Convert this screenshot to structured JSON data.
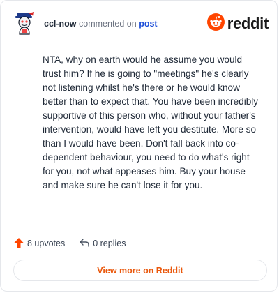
{
  "header": {
    "username": "ccl-now",
    "action": "commented on",
    "post_link": "post",
    "brand": "reddit"
  },
  "comment": {
    "text": "NTA, why on earth would he assume you would trust him? If he is going to \"meetings\" he's clearly not listening whilst he's there or he would know better than to expect that. You have been incredibly supportive of this person who, without your father's intervention, would have left you destitute. More so than I would have been. Don't fall back into co-dependent behaviour, you need to do what's right for you, not what appeases him. Buy your house and make sure he can't lose it for you."
  },
  "stats": {
    "upvotes": "8 upvotes",
    "replies": "0 replies"
  },
  "footer": {
    "view_more": "View more on Reddit"
  },
  "colors": {
    "brand_orange": "#ff4500",
    "link_blue": "#1d4ed8",
    "cta_orange": "#ea580c"
  },
  "icons": {
    "avatar": "snoo-avatar-icon",
    "brand": "reddit-logo-icon",
    "upvote": "upvote-arrow-icon",
    "reply": "reply-arrow-icon"
  }
}
